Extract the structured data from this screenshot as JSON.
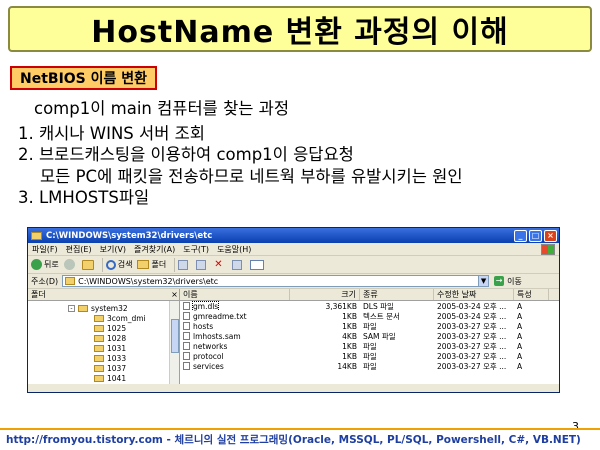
{
  "slide": {
    "title": "HostName 변환 과정의 이해",
    "subtitle": "NetBIOS 이름 변환",
    "lines": {
      "intro": "comp1이  main 컴퓨터를 찾는 과정",
      "l1": "1. 캐시나 WINS 서버 조회",
      "l2": "2. 브로드캐스팅을 이용하여 comp1이 응답요청",
      "l2b": "모든 PC에 패킷을 전송하므로 네트웍 부하를 유발시키는 원인",
      "l3": "3. LMHOSTS파일"
    },
    "page_number": "3",
    "footer": "http://fromyou.tistory.com - 체르니의 실전 프로그래밍(Oracle, MSSQL, PL/SQL, Powershell, C#, VB.NET)",
    "colors": {
      "title_bg": "#ffff99",
      "subtitle_bg": "#ffcc66",
      "subtitle_border": "#cc0000",
      "footer_text": "#1f3fa0",
      "footer_bar": "#f0a000"
    }
  },
  "explorer": {
    "window_title": "C:\\WINDOWS\\system32\\drivers\\etc",
    "window_buttons": {
      "minimize": "_",
      "maximize": "□",
      "close": "×"
    },
    "menu": [
      "파일(F)",
      "편집(E)",
      "보기(V)",
      "즐겨찾기(A)",
      "도구(T)",
      "도움말(H)"
    ],
    "toolbar": {
      "back": "뒤로",
      "search": "검색",
      "folders": "폴더"
    },
    "address": {
      "label": "주소(D)",
      "value": "C:\\WINDOWS\\system32\\drivers\\etc",
      "go": "이동"
    },
    "folder_pane": {
      "header": "폴더",
      "close": "×",
      "items": [
        {
          "label": "system32",
          "expander": "-"
        },
        {
          "label": "3com_dmi",
          "expander": ""
        },
        {
          "label": "1025",
          "expander": ""
        },
        {
          "label": "1028",
          "expander": ""
        },
        {
          "label": "1031",
          "expander": ""
        },
        {
          "label": "1033",
          "expander": ""
        },
        {
          "label": "1037",
          "expander": ""
        },
        {
          "label": "1041",
          "expander": ""
        }
      ]
    },
    "file_pane": {
      "columns": [
        "이름",
        "크기",
        "종류",
        "수정한 날짜",
        "특성"
      ],
      "rows": [
        {
          "name": "gm.dls",
          "size": "3,361KB",
          "type": "DLS 파일",
          "date": "2005-03-24 오후 ...",
          "attr": "A"
        },
        {
          "name": "gmreadme.txt",
          "size": "1KB",
          "type": "텍스트 문서",
          "date": "2005-03-24 오후 ...",
          "attr": "A"
        },
        {
          "name": "hosts",
          "size": "1KB",
          "type": "파일",
          "date": "2003-03-27 오후 ...",
          "attr": "A"
        },
        {
          "name": "lmhosts.sam",
          "size": "4KB",
          "type": "SAM 파일",
          "date": "2003-03-27 오후 ...",
          "attr": "A"
        },
        {
          "name": "networks",
          "size": "1KB",
          "type": "파일",
          "date": "2003-03-27 오후 ...",
          "attr": "A"
        },
        {
          "name": "protocol",
          "size": "1KB",
          "type": "파일",
          "date": "2003-03-27 오후 ...",
          "attr": "A"
        },
        {
          "name": "services",
          "size": "14KB",
          "type": "파일",
          "date": "2003-03-27 오후 ...",
          "attr": "A"
        }
      ]
    }
  }
}
